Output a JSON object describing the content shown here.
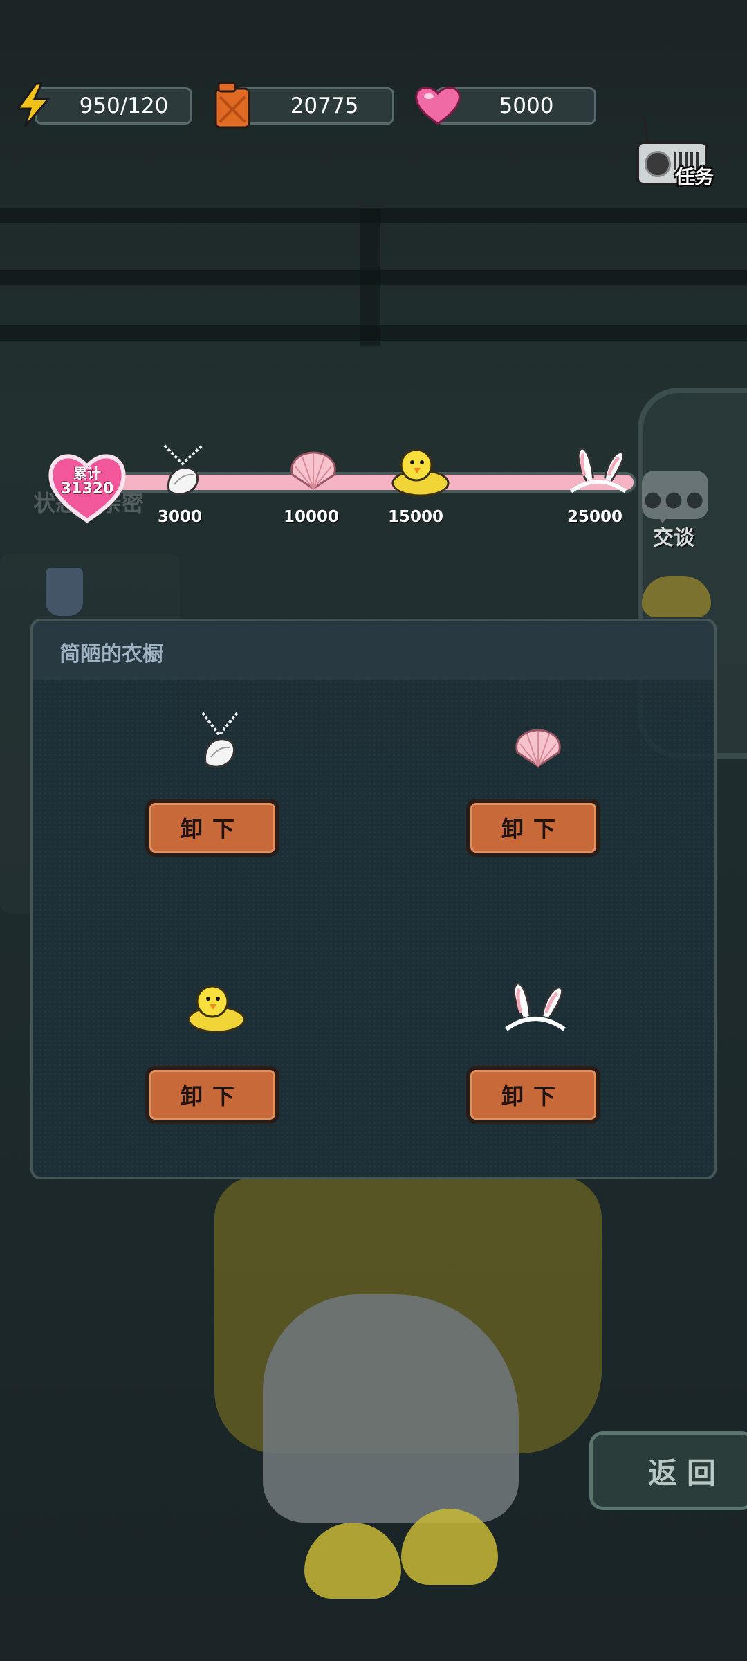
{
  "resources": {
    "energy": {
      "value": "950/120",
      "icon": "lightning-icon"
    },
    "fuel": {
      "value": "20775",
      "icon": "fuel-can-icon"
    },
    "hearts": {
      "value": "5000",
      "icon": "heart-icon"
    }
  },
  "task": {
    "label": "任务",
    "icon": "radio-icon"
  },
  "affection": {
    "total_label": "累计",
    "total_value": "31320",
    "progress_fraction": 1.0,
    "milestones": [
      {
        "value": "3000",
        "icon": "shell-necklace-icon"
      },
      {
        "value": "10000",
        "icon": "seashell-icon"
      },
      {
        "value": "15000",
        "icon": "duck-slipper-icon"
      },
      {
        "value": "25000",
        "icon": "bunny-ears-icon"
      }
    ],
    "hidden_label": "状态：亲密"
  },
  "talk": {
    "label": "交谈"
  },
  "wardrobe": {
    "title": "简陋的衣橱",
    "slots": [
      {
        "icon": "shell-necklace-icon",
        "button": "卸下"
      },
      {
        "icon": "seashell-icon",
        "button": "卸下"
      },
      {
        "icon": "duck-slipper-icon",
        "button": "卸下"
      },
      {
        "icon": "bunny-ears-icon",
        "button": "卸下"
      }
    ]
  },
  "return_button": {
    "label": "返回"
  },
  "colors": {
    "accent_orange": "#c8693a",
    "progress_pink": "#f4b4c3",
    "panel_bg": "#1e3038"
  }
}
